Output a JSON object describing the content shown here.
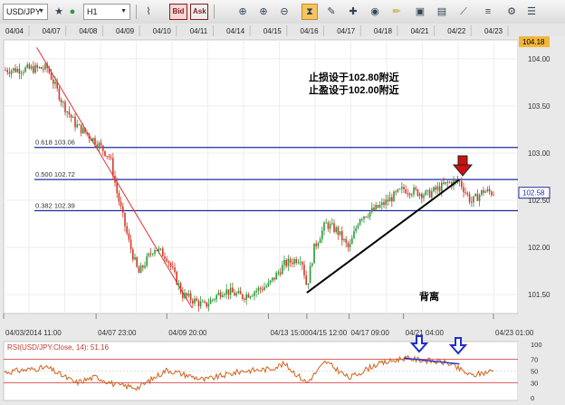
{
  "toolbar": {
    "symbol": "USD/JPY",
    "timeframe": "H1",
    "bid_label": "Bid",
    "ask_label": "Ask",
    "icons": [
      "globe-icon",
      "line-chart-icon",
      "bid-icon",
      "ask-icon",
      "magnet-icon",
      "zoom-in-icon",
      "zoom-out-icon",
      "zoom-fit-icon",
      "hourglass-icon",
      "note-icon",
      "color-wheel-icon",
      "pencil-icon",
      "image-icon",
      "save-icon",
      "draw-tools-icon",
      "indicators-icon",
      "settings-icon"
    ]
  },
  "top_dates": [
    "04/04",
    "04/07",
    "04/08",
    "04/09",
    "04/10",
    "04/11",
    "04/14",
    "04/15",
    "04/16",
    "04/17",
    "04/18",
    "04/21",
    "04/22",
    "04/23"
  ],
  "bottom_dates": [
    "04/03/2014 11:00",
    "04/07 23:00",
    "04/09 20:00",
    "04/13 15:00",
    "04/15 12:00",
    "04/17 09:00",
    "04/21 04:00",
    "04/23 01:00"
  ],
  "annotations": {
    "stop_loss": "止损设于102.80附近",
    "take_profit": "止盈设于102.00附近",
    "divergence": "背离"
  },
  "colors": {
    "up_candle": "#2a9a3a",
    "down_candle": "#d23a2a",
    "fib_line": "#1f2d9c",
    "trendline": "#000000",
    "fib_fan": "#e03030",
    "rsi_line": "#d0631c",
    "arrow_red": "#cc1111",
    "arrow_blue": "#1e30c8",
    "price_tag": "#f2b63c"
  },
  "chart_data": [
    {
      "type": "candlestick",
      "title": "",
      "instrument": "USD/JPY",
      "timeframe": "H1",
      "ylim": [
        101.3,
        104.2
      ],
      "y_ticks": [
        104.18,
        104.0,
        103.5,
        103.0,
        102.58,
        102.5,
        102.0,
        101.5
      ],
      "current_price": 102.58,
      "high_marker": 104.18,
      "fib_levels": [
        {
          "label": "0.618 103.06",
          "value": 103.06
        },
        {
          "label": "0.500 102.72",
          "value": 102.72
        },
        {
          "label": "0.382 102.39",
          "value": 102.39
        }
      ],
      "trendline": {
        "from": {
          "time": "04/15 12:00",
          "price": 101.52
        },
        "to": {
          "time": "04/22",
          "price": 102.72
        }
      },
      "fib_fan_line": {
        "from": {
          "time": "04/04",
          "price": 104.12
        },
        "to": {
          "time": "04/10",
          "price": 101.36
        }
      },
      "waypoints": [
        {
          "t": "04/03 11:00",
          "p": 103.88
        },
        {
          "t": "04/04 20:00",
          "p": 103.9
        },
        {
          "t": "04/07 02:00",
          "p": 103.52
        },
        {
          "t": "04/07 10:00",
          "p": 103.3
        },
        {
          "t": "04/07 23:00",
          "p": 103.12
        },
        {
          "t": "04/08 08:00",
          "p": 102.95
        },
        {
          "t": "04/08 12:00",
          "p": 102.6
        },
        {
          "t": "04/08 20:00",
          "p": 102.05
        },
        {
          "t": "04/09 02:00",
          "p": 101.72
        },
        {
          "t": "04/09 12:00",
          "p": 102.0
        },
        {
          "t": "04/09 20:00",
          "p": 101.9
        },
        {
          "t": "04/10 06:00",
          "p": 101.5
        },
        {
          "t": "04/10 20:00",
          "p": 101.38
        },
        {
          "t": "04/11 08:00",
          "p": 101.55
        },
        {
          "t": "04/11 20:00",
          "p": 101.48
        },
        {
          "t": "04/13 15:00",
          "p": 101.6
        },
        {
          "t": "04/14 12:00",
          "p": 101.82
        },
        {
          "t": "04/15 06:00",
          "p": 101.9
        },
        {
          "t": "04/15 12:00",
          "p": 101.58
        },
        {
          "t": "04/15 20:00",
          "p": 102.0
        },
        {
          "t": "04/16 08:00",
          "p": 102.25
        },
        {
          "t": "04/16 20:00",
          "p": 102.18
        },
        {
          "t": "04/17 09:00",
          "p": 101.98
        },
        {
          "t": "04/17 20:00",
          "p": 102.32
        },
        {
          "t": "04/18 12:00",
          "p": 102.4
        },
        {
          "t": "04/18 20:00",
          "p": 102.45
        },
        {
          "t": "04/21 04:00",
          "p": 102.62
        },
        {
          "t": "04/21 16:00",
          "p": 102.56
        },
        {
          "t": "04/22 02:00",
          "p": 102.68
        },
        {
          "t": "04/22 08:00",
          "p": 102.7
        },
        {
          "t": "04/22 14:00",
          "p": 102.48
        },
        {
          "t": "04/22 20:00",
          "p": 102.6
        },
        {
          "t": "04/23 01:00",
          "p": 102.58
        }
      ]
    },
    {
      "type": "line",
      "title": "RSI(USD/JPY.Close, 14): 51.16",
      "ylim": [
        0,
        100
      ],
      "y_ticks": [
        100,
        70,
        50,
        30,
        0
      ],
      "current_value": 51.16,
      "waypoints": [
        {
          "t": "04/03 11:00",
          "v": 48
        },
        {
          "t": "04/04 20:00",
          "v": 56
        },
        {
          "t": "04/07 10:00",
          "v": 30
        },
        {
          "t": "04/07 23:00",
          "v": 40
        },
        {
          "t": "04/08 12:00",
          "v": 26
        },
        {
          "t": "04/09 02:00",
          "v": 22
        },
        {
          "t": "04/09 20:00",
          "v": 52
        },
        {
          "t": "04/10 20:00",
          "v": 35
        },
        {
          "t": "04/11 20:00",
          "v": 50
        },
        {
          "t": "04/13 15:00",
          "v": 53
        },
        {
          "t": "04/14 12:00",
          "v": 62
        },
        {
          "t": "04/15 12:00",
          "v": 30
        },
        {
          "t": "04/16 08:00",
          "v": 66
        },
        {
          "t": "04/17 09:00",
          "v": 38
        },
        {
          "t": "04/18 12:00",
          "v": 60
        },
        {
          "t": "04/21 04:00",
          "v": 72
        },
        {
          "t": "04/22 02:00",
          "v": 64
        },
        {
          "t": "04/22 14:00",
          "v": 42
        },
        {
          "t": "04/23 01:00",
          "v": 51
        }
      ],
      "divergence_line": {
        "from": {
          "t": "04/21 04:00",
          "v": 72
        },
        "to": {
          "t": "04/22 08:00",
          "v": 62
        }
      }
    }
  ]
}
